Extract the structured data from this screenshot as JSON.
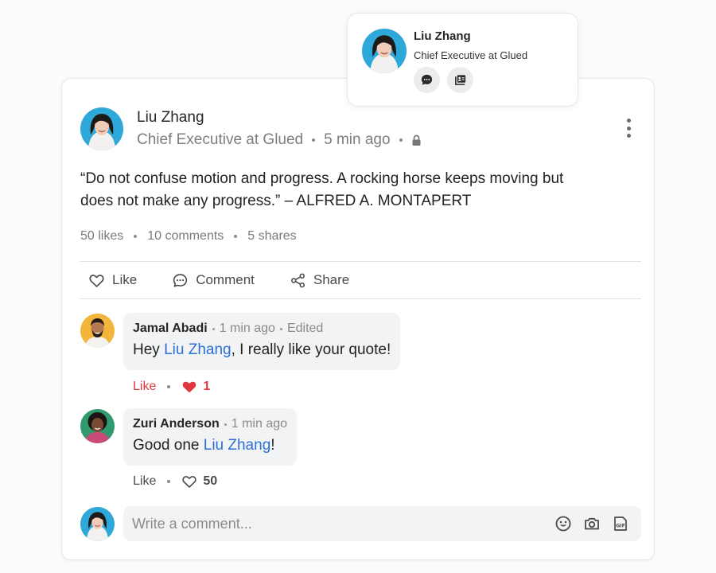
{
  "colors": {
    "accent_link": "#2c6fd6",
    "like_active": "#e0383e",
    "bubble_bg": "#f2f3f4"
  },
  "post": {
    "author": {
      "name": "Liu Zhang",
      "title": "Chief Executive at Glued",
      "avatar": "liu-zhang-avatar"
    },
    "time": "5 min ago",
    "visibility_icon": "lock-icon",
    "text": "“Do not confuse motion and progress. A rocking horse keeps moving but does not make any progress.” – ALFRED A. MONTAPERT",
    "stats": {
      "likes": "50 likes",
      "comments": "10 comments",
      "shares": "5 shares"
    },
    "actions": {
      "like": "Like",
      "comment": "Comment",
      "share": "Share"
    }
  },
  "comments": [
    {
      "name": "Jamal Abadi",
      "time": "1 min ago",
      "edited": "Edited",
      "text_before": "Hey ",
      "mention": "Liu Zhang",
      "text_after": ", I really like your quote!",
      "like_label": "Like",
      "liked": true,
      "reaction_count": "1"
    },
    {
      "name": "Zuri Anderson",
      "time": "1 min ago",
      "text_before": "Good one ",
      "mention": "Liu Zhang",
      "text_after": "!",
      "like_label": "Like",
      "liked": false,
      "reaction_count": "50"
    }
  ],
  "composer": {
    "placeholder": "Write a comment...",
    "icons": [
      "emoji-icon",
      "camera-icon",
      "gif-icon"
    ]
  },
  "hover_card": {
    "name": "Liu Zhang",
    "title": "Chief Executive at Glued",
    "buttons": [
      "message-icon",
      "profile-card-icon"
    ]
  }
}
